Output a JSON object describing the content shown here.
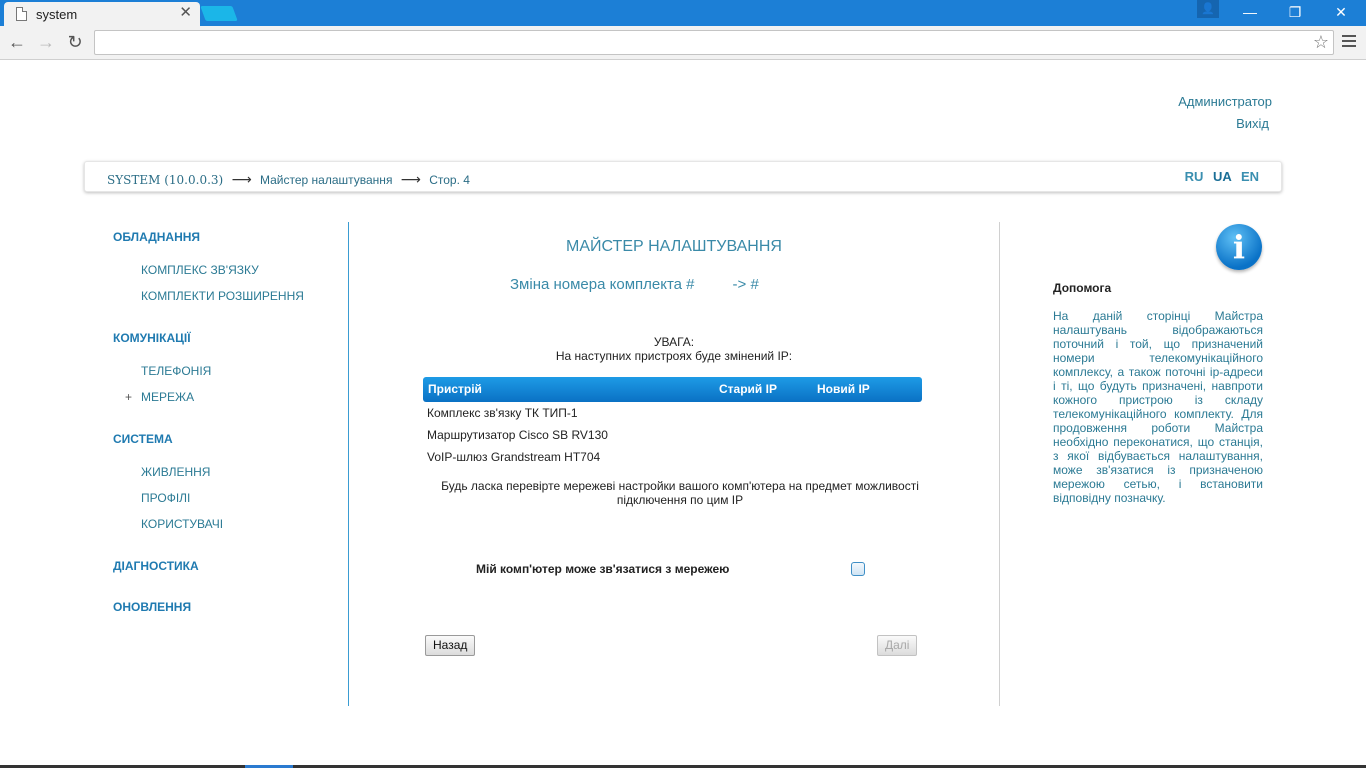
{
  "browser": {
    "tab_title": "system",
    "tab_close": "✕",
    "back_icon": "←",
    "forward_icon": "→",
    "reload_icon": "↻",
    "star_icon": "☆",
    "url": "",
    "win_user": "👤",
    "win_minimize": "—",
    "win_restore": "❐",
    "win_close": "✕"
  },
  "user": {
    "name": "Администратор",
    "logout": "Вихід"
  },
  "breadcrumb": {
    "system": "SYSTEM (10.0.0.3)",
    "arrow": "⟶",
    "wizard": "Майстер налаштування",
    "page": "Стор. 4"
  },
  "languages": [
    "RU",
    "UA",
    "EN"
  ],
  "sidebar": {
    "hardware": "ОБЛАДНАННЯ",
    "hardware_items": [
      "КОМПЛЕКС ЗВ'ЯЗКУ",
      "КОМПЛЕКТИ РОЗШИРЕННЯ"
    ],
    "communications": "КОМУНІКАЦІЇ",
    "communications_items": [
      "ТЕЛЕФОНІЯ",
      "МЕРЕЖА"
    ],
    "expand_marker": "+",
    "system": "СИСТЕМА",
    "system_items": [
      "ЖИВЛЕННЯ",
      "ПРОФІЛІ",
      "КОРИСТУВАЧІ"
    ],
    "diagnostics": "ДІАГНОСТИКА",
    "updates": "ОНОВЛЕННЯ"
  },
  "wizard": {
    "title": "МАЙСТЕР НАЛАШТУВАННЯ",
    "subtitle_left": "Зміна номера комплекта #",
    "subtitle_right": "-> #",
    "warning_title": "УВАГА:",
    "warning_text": "На наступних пристроях буде змінений IP:",
    "table": {
      "headers": [
        "Пристрій",
        "Старий IP",
        "Новий IP"
      ],
      "rows": [
        "Комплекс зв'язку ТК ТИП-1",
        "Маршрутизатор Cisco SB RV130",
        "VoIP-шлюз Grandstream HT704"
      ]
    },
    "check_note": "Будь ласка перевірте мережеві настройки вашого комп'ютера на предмет можливості підключення по цим IP",
    "connect_label": "Мій комп'ютер може зв'язатися з мережею",
    "back_button": "Назад",
    "next_button": "Далі"
  },
  "help": {
    "icon": "i",
    "title": "Допомога",
    "text": "На даній сторінці Майстра налаштувань відображаються поточний і той, що призначений номери телекомунікаційного комплексу, а також поточні ip-адреси і ті, що будуть призначені, навпроти кожного пристрою із складу телекомунікаційного комплекту. Для продовження роботи Майстра необхідно переконатися, що станція, з якої відбувається налаштування, може зв'язатися із призначеною мережою сетью, і встановити відповідну позначку."
  }
}
